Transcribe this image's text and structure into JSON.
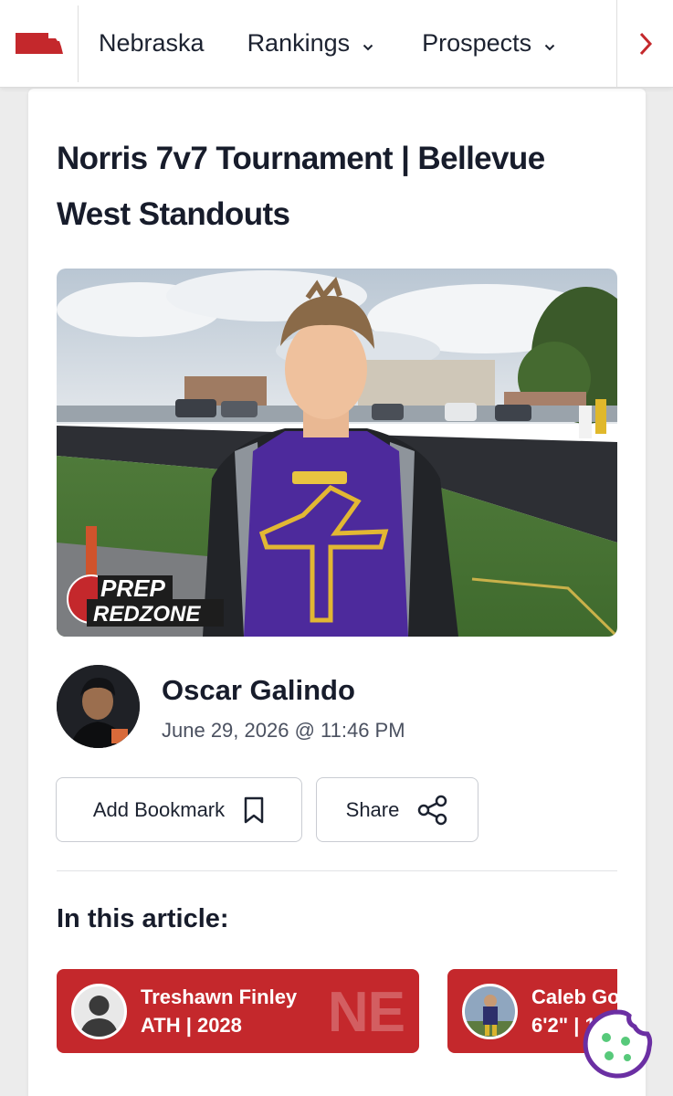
{
  "nav": {
    "items": [
      "Nebraska",
      "Rankings",
      "Prospects"
    ]
  },
  "article": {
    "title": "Norris 7v7 Tournament | Bellevue West Standouts",
    "hero_watermark": [
      "PREP",
      "REDZONE"
    ],
    "author": {
      "name": "Oscar Galindo",
      "date": "June 29, 2026 @ 11:46 PM"
    },
    "actions": {
      "bookmark_label": "Add Bookmark",
      "share_label": "Share"
    },
    "in_article_heading": "In this article:",
    "players": [
      {
        "name": "Treshawn Finley",
        "meta": "ATH | 2028",
        "state": "NE"
      },
      {
        "name": "Caleb Go",
        "meta": "6'2\" | 1"
      }
    ]
  },
  "colors": {
    "brand_red": "#c4282c",
    "text_dark": "#171c2b",
    "cookie_purple": "#6b2fa3"
  }
}
